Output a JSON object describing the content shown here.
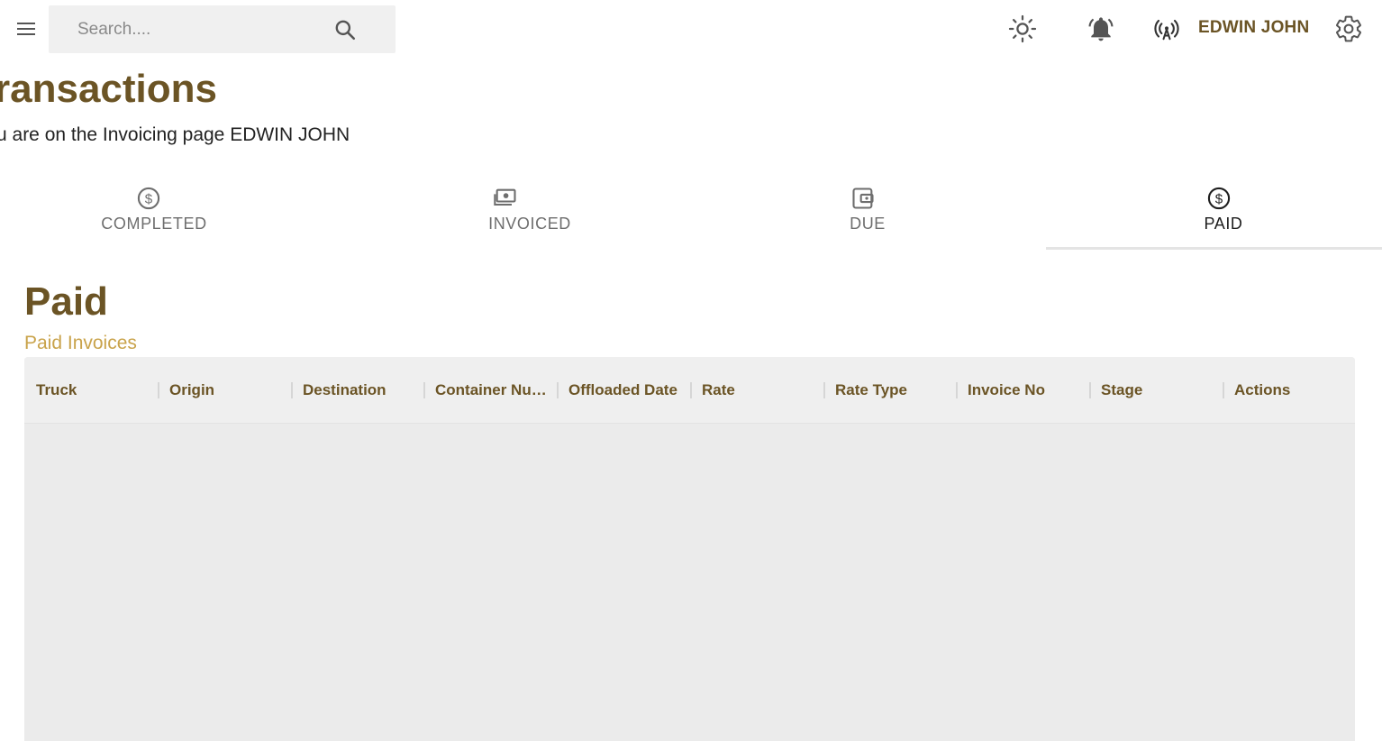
{
  "topbar": {
    "menu_icon": "hamburger-menu-icon",
    "search_placeholder": "Search....",
    "search_icon": "search-icon",
    "theme_icon": "sun-icon",
    "notification_icon": "bell-icon",
    "broadcast_icon": "antenna-icon",
    "user_name": "EDWIN JOHN",
    "settings_icon": "gear-icon"
  },
  "page": {
    "title": "ransactions",
    "subtitle": "u are on the Invoicing page EDWIN JOHN"
  },
  "tabs": [
    {
      "label": "COMPLETED",
      "icon": "dollar-circle-icon",
      "active": false
    },
    {
      "label": "INVOICED",
      "icon": "money-bill-icon",
      "active": false
    },
    {
      "label": "DUE",
      "icon": "wallet-icon",
      "active": false
    },
    {
      "label": "PAID",
      "icon": "dollar-circle-icon",
      "active": true
    }
  ],
  "section": {
    "title": "Paid",
    "subtitle": "Paid Invoices"
  },
  "table": {
    "columns": [
      "Truck",
      "Origin",
      "Destination",
      "Container Num...",
      "Offloaded Date",
      "Rate",
      "Rate Type",
      "Invoice No",
      "Stage",
      "Actions"
    ],
    "rows": []
  },
  "colors": {
    "brand_brown": "#6b5425",
    "accent_gold": "#c9a34b",
    "grid_bg": "#ebebeb"
  }
}
